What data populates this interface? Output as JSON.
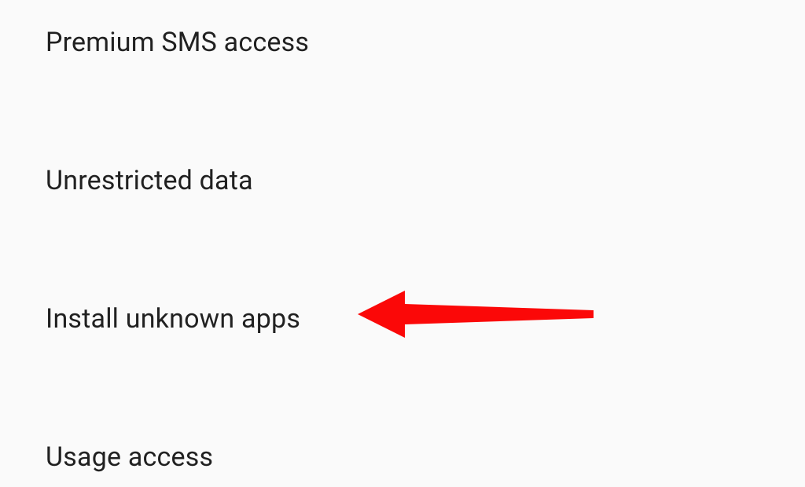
{
  "settings": {
    "items": [
      {
        "label": "Premium SMS access"
      },
      {
        "label": "Unrestricted data"
      },
      {
        "label": "Install unknown apps"
      },
      {
        "label": "Usage access"
      }
    ]
  },
  "annotation": {
    "arrow_color": "#fb0808",
    "target": "install-unknown-apps"
  }
}
